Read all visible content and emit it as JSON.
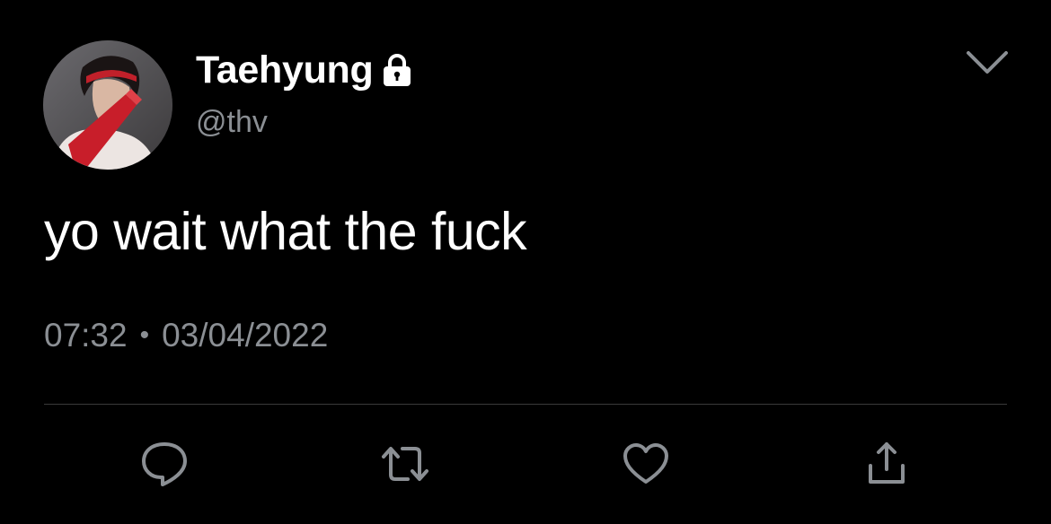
{
  "tweet": {
    "display_name": "Taehyung",
    "handle": "@thv",
    "text": "yo wait what the fuck",
    "time": "07:32",
    "separator": "•",
    "date": "03/04/2022",
    "protected": true
  },
  "icons": {
    "lock": "lock-icon",
    "menu": "chevron-down-icon",
    "reply": "reply-icon",
    "retweet": "retweet-icon",
    "like": "heart-icon",
    "share": "share-icon"
  },
  "colors": {
    "background": "#000000",
    "primary_text": "#ffffff",
    "secondary_text": "#8b8f94",
    "divider": "#3a3a3a",
    "icon": "#8b8f94"
  }
}
